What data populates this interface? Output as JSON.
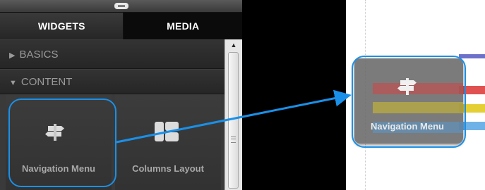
{
  "tabs": [
    {
      "label": "WIDGETS",
      "selected": true
    },
    {
      "label": "MEDIA",
      "selected": false
    }
  ],
  "categories": [
    {
      "arrow": "▶",
      "label": "BASICS",
      "expanded": false
    },
    {
      "arrow": "▼",
      "label": "CONTENT",
      "expanded": true
    }
  ],
  "widgets": [
    {
      "label": "Navigation Menu",
      "icon": "signpost-icon"
    },
    {
      "label": "Columns Layout",
      "icon": "columns-layout-icon"
    }
  ],
  "scrollbar": {
    "up_arrow": "▲"
  },
  "drag_preview": {
    "label": "Navigation Menu",
    "icon": "signpost-icon"
  },
  "colors": {
    "highlight": "#1a90e8",
    "stripe_purple": "#6e71c9",
    "stripe_red": "#e05252",
    "stripe_yellow": "#e4cf34",
    "stripe_blue": "#6fb2e8"
  }
}
